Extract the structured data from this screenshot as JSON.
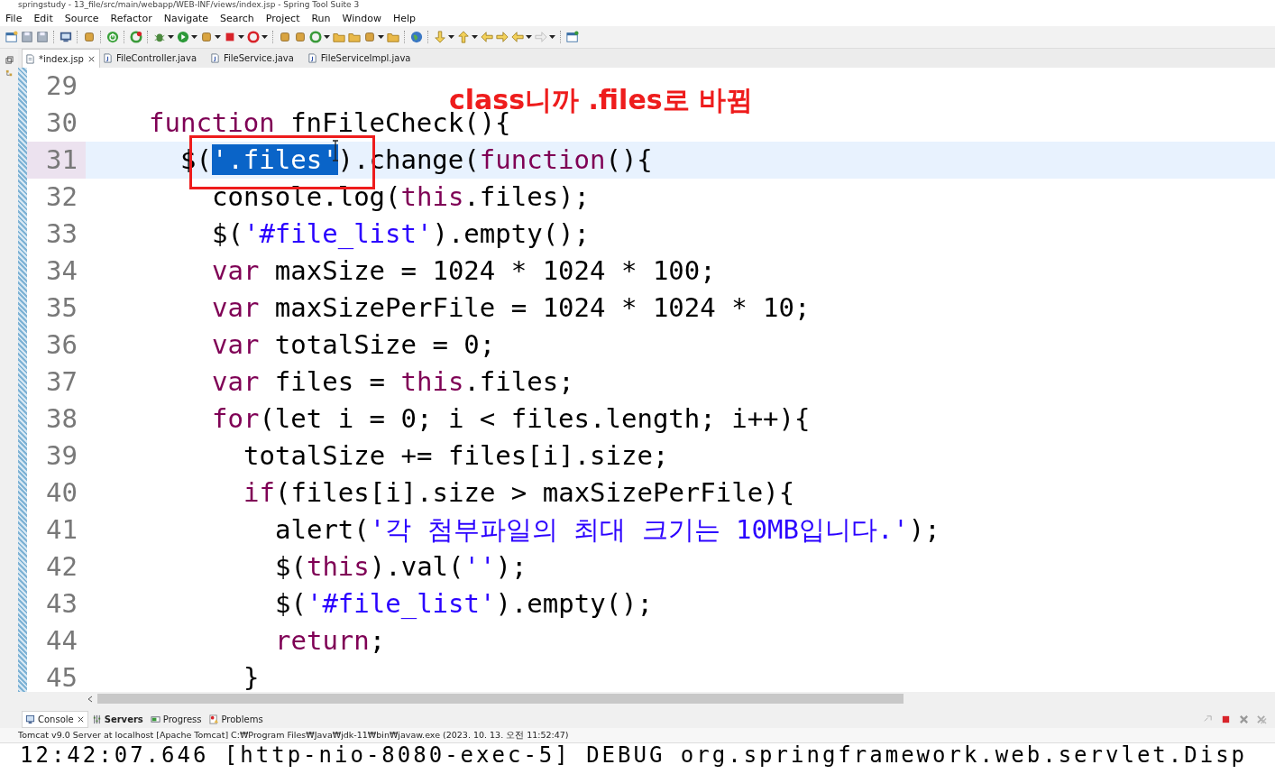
{
  "window": {
    "title": "springstudy - 13_file/src/main/webapp/WEB-INF/views/index.jsp - Spring Tool Suite 3"
  },
  "menu": [
    "File",
    "Edit",
    "Source",
    "Refactor",
    "Navigate",
    "Search",
    "Project",
    "Run",
    "Window",
    "Help"
  ],
  "editor_tabs": [
    {
      "label": "*index.jsp",
      "kind": "jsp",
      "selected": true,
      "closable": true
    },
    {
      "label": "FileController.java",
      "kind": "java",
      "selected": false,
      "closable": false
    },
    {
      "label": "FileService.java",
      "kind": "java",
      "selected": false,
      "closable": false
    },
    {
      "label": "FileServiceImpl.java",
      "kind": "java",
      "selected": false,
      "closable": false
    }
  ],
  "annotation": "class니까 .files로 바뀜",
  "code_lines": [
    {
      "number": "29",
      "current": false
    },
    {
      "number": "30",
      "current": false,
      "tokens": [
        {
          "text": "function",
          "kind": "keyword"
        },
        {
          "text": " fnFileCheck(){",
          "kind": "plain"
        }
      ],
      "children": [
        {
          "number": "31",
          "current": true,
          "tokens": [
            {
              "text": "$(",
              "kind": "plain"
            },
            {
              "text": "'.files'",
              "kind": "selection"
            },
            {
              "text": ").change(",
              "kind": "plain"
            },
            {
              "text": "function",
              "kind": "keyword"
            },
            {
              "text": "(){",
              "kind": "plain"
            }
          ],
          "children": [
            {
              "number": "32",
              "current": false,
              "tokens": [
                {
                  "text": "console.log(",
                  "kind": "plain"
                },
                {
                  "text": "this",
                  "kind": "keyword"
                },
                {
                  "text": ".files);",
                  "kind": "plain"
                }
              ]
            },
            {
              "number": "33",
              "current": false,
              "tokens": [
                {
                  "text": "$(",
                  "kind": "plain"
                },
                {
                  "text": "'#file_list'",
                  "kind": "string"
                },
                {
                  "text": ").empty();",
                  "kind": "plain"
                }
              ]
            },
            {
              "number": "34",
              "current": false,
              "tokens": [
                {
                  "text": "var",
                  "kind": "keyword"
                },
                {
                  "text": " maxSize = 1024 * 1024 * 100;",
                  "kind": "plain"
                }
              ]
            },
            {
              "number": "35",
              "current": false,
              "tokens": [
                {
                  "text": "var",
                  "kind": "keyword"
                },
                {
                  "text": " maxSizePerFile = 1024 * 1024 * 10;",
                  "kind": "plain"
                }
              ]
            },
            {
              "number": "36",
              "current": false,
              "tokens": [
                {
                  "text": "var",
                  "kind": "keyword"
                },
                {
                  "text": " totalSize = 0;",
                  "kind": "plain"
                }
              ]
            },
            {
              "number": "37",
              "current": false,
              "tokens": [
                {
                  "text": "var",
                  "kind": "keyword"
                },
                {
                  "text": " files = ",
                  "kind": "plain"
                },
                {
                  "text": "this",
                  "kind": "keyword"
                },
                {
                  "text": ".files;",
                  "kind": "plain"
                }
              ]
            },
            {
              "number": "38",
              "current": false,
              "tokens": [
                {
                  "text": "for",
                  "kind": "keyword"
                },
                {
                  "text": "(let i = 0; i < files.length; i++){",
                  "kind": "plain"
                }
              ],
              "children": [
                {
                  "number": "39",
                  "current": false,
                  "tokens": [
                    {
                      "text": "totalSize += files[i].size;",
                      "kind": "plain"
                    }
                  ]
                },
                {
                  "number": "40",
                  "current": false,
                  "tokens": [
                    {
                      "text": "if",
                      "kind": "keyword"
                    },
                    {
                      "text": "(files[i].size > maxSizePerFile){",
                      "kind": "plain"
                    }
                  ],
                  "children": [
                    {
                      "number": "41",
                      "current": false,
                      "tokens": [
                        {
                          "text": "alert(",
                          "kind": "plain"
                        },
                        {
                          "text": "'각 첨부파일의 최대 크기는 10MB입니다.'",
                          "kind": "string"
                        },
                        {
                          "text": ");",
                          "kind": "plain"
                        }
                      ]
                    },
                    {
                      "number": "42",
                      "current": false,
                      "tokens": [
                        {
                          "text": "$(",
                          "kind": "plain"
                        },
                        {
                          "text": "this",
                          "kind": "keyword"
                        },
                        {
                          "text": ").val(",
                          "kind": "plain"
                        },
                        {
                          "text": "''",
                          "kind": "string"
                        },
                        {
                          "text": ");",
                          "kind": "plain"
                        }
                      ]
                    },
                    {
                      "number": "43",
                      "current": false,
                      "tokens": [
                        {
                          "text": "$(",
                          "kind": "plain"
                        },
                        {
                          "text": "'#file_list'",
                          "kind": "string"
                        },
                        {
                          "text": ").empty();",
                          "kind": "plain"
                        }
                      ]
                    },
                    {
                      "number": "44",
                      "current": false,
                      "tokens": [
                        {
                          "text": "return",
                          "kind": "keyword"
                        },
                        {
                          "text": ";",
                          "kind": "plain"
                        }
                      ]
                    }
                  ]
                },
                {
                  "number": "45",
                  "current": false,
                  "tokens": [
                    {
                      "text": "}",
                      "kind": "plain"
                    }
                  ]
                }
              ]
            }
          ]
        }
      ]
    }
  ],
  "panel_tabs": [
    {
      "label": "Console",
      "kind": "console",
      "selected": true,
      "closable": true
    },
    {
      "label": "Servers",
      "kind": "servers",
      "selected": false,
      "closable": false
    },
    {
      "label": "Progress",
      "kind": "progress",
      "selected": false,
      "closable": false
    },
    {
      "label": "Problems",
      "kind": "problems",
      "selected": false,
      "closable": false
    }
  ],
  "console": {
    "process": "Tomcat v9.0 Server at localhost [Apache Tomcat] C:₩Program Files₩Java₩jdk-11₩bin₩javaw.exe  (2023. 10. 13. 오전 11:52:47)",
    "output": "12:42:07.646 [http-nio-8080-exec-5] DEBUG org.springframework.web.servlet.Disp"
  }
}
